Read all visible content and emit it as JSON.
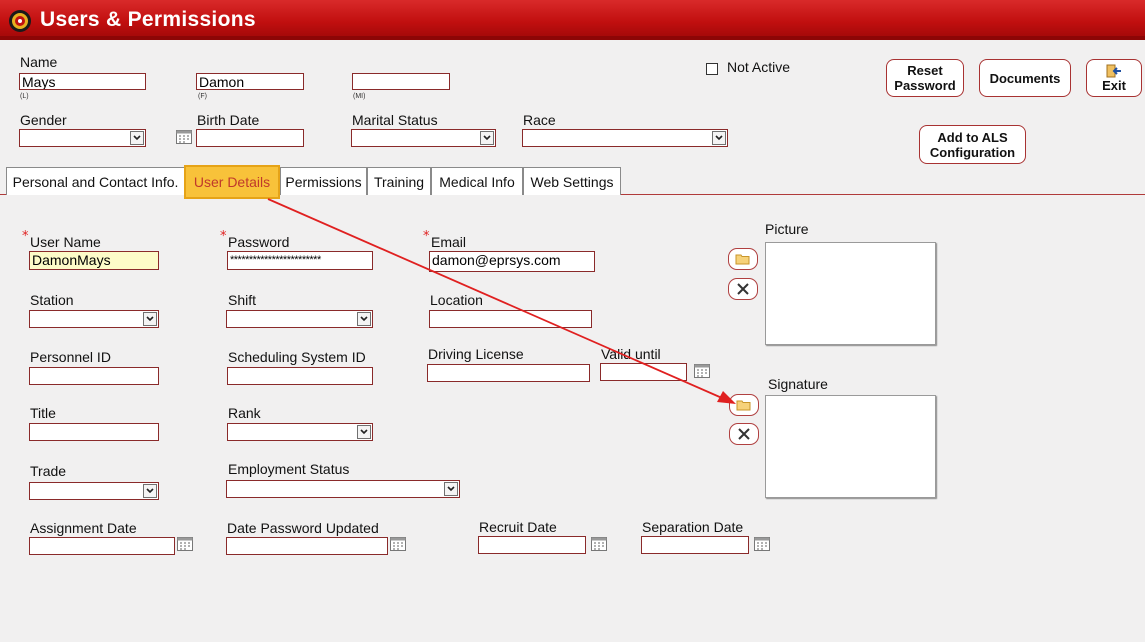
{
  "window": {
    "title": "Users & Permissions"
  },
  "header": {
    "name_label": "Name",
    "last": "Mays",
    "last_sub": "(L)",
    "first": "Damon",
    "first_sub": "(F)",
    "middle": "",
    "middle_sub": "(MI)",
    "not_active_label": "Not Active",
    "gender_label": "Gender",
    "gender_value": "",
    "birth_label": "Birth Date",
    "birth_value": "",
    "marital_label": "Marital Status",
    "marital_value": "",
    "race_label": "Race",
    "race_value": ""
  },
  "buttons": {
    "reset_line1": "Reset",
    "reset_line2": "Password",
    "documents": "Documents",
    "exit": "Exit",
    "als_line1": "Add to ALS",
    "als_line2": "Configuration"
  },
  "tabs": [
    {
      "label": "Personal and Contact Info."
    },
    {
      "label": "User Details"
    },
    {
      "label": "Permissions"
    },
    {
      "label": "Training"
    },
    {
      "label": "Medical Info"
    },
    {
      "label": "Web Settings"
    }
  ],
  "form": {
    "username_label": "User Name",
    "username_value": "DamonMays",
    "password_label": "Password",
    "password_value": "************************",
    "email_label": "Email",
    "email_value": "damon@eprsys.com",
    "station_label": "Station",
    "station_value": "",
    "shift_label": "Shift",
    "shift_value": "",
    "location_label": "Location",
    "location_value": "",
    "personnel_label": "Personnel ID",
    "personnel_value": "",
    "sched_label": "Scheduling System ID",
    "sched_value": "",
    "license_label": "Driving License",
    "license_value": "",
    "valid_label": "Valid until",
    "valid_value": "",
    "title_label": "Title",
    "title_value": "",
    "rank_label": "Rank",
    "rank_value": "",
    "trade_label": "Trade",
    "trade_value": "",
    "employment_label": "Employment Status",
    "employment_value": "",
    "assign_label": "Assignment Date",
    "assign_value": "",
    "pwdate_label": "Date Password Updated",
    "pwdate_value": "",
    "recruit_label": "Recruit Date",
    "recruit_value": "",
    "separation_label": "Separation Date",
    "separation_value": "",
    "picture_label": "Picture",
    "signature_label": "Signature"
  },
  "colors": {
    "titlebar": "#c10f0f",
    "active_tab": "#f8c23a",
    "annotation_arrow": "#e02020",
    "required_field": "#fdfbc8"
  },
  "icons": [
    "logo-icon",
    "checkbox-icon",
    "calendar-icon",
    "folder-icon",
    "delete-x-icon",
    "exit-icon",
    "chevron-down-icon"
  ]
}
